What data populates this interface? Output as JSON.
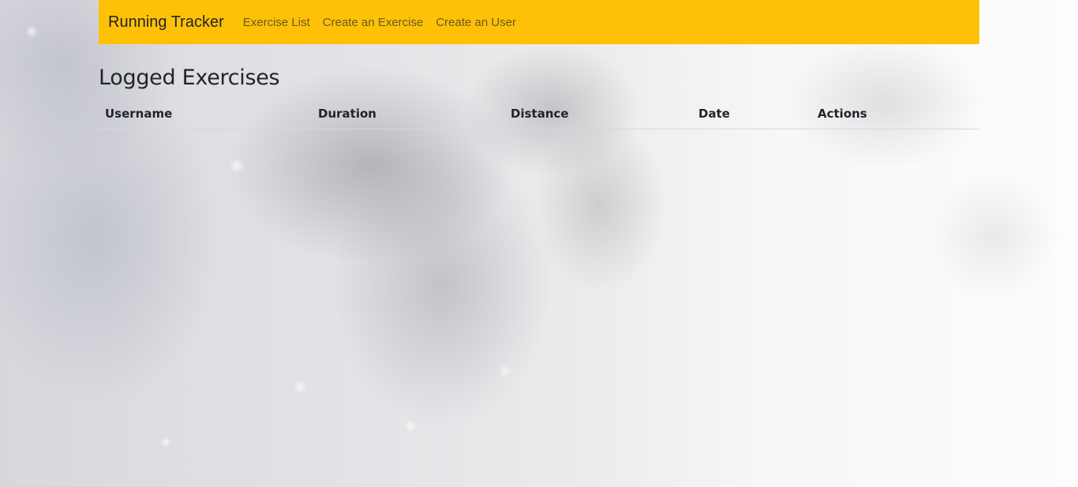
{
  "navbar": {
    "brand": "Running Tracker",
    "links": [
      "Exercise List",
      "Create an Exercise",
      "Create an User"
    ],
    "background": "#ffc107"
  },
  "main": {
    "title": "Logged Exercises",
    "table": {
      "headers": [
        "Username",
        "Duration",
        "Distance",
        "Date",
        "Actions"
      ],
      "rows": []
    }
  }
}
